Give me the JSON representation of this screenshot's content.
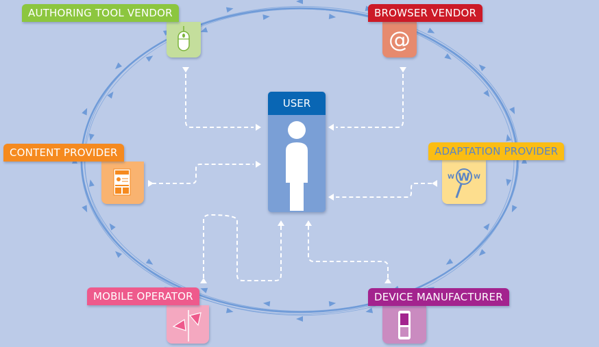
{
  "diagram": {
    "center": {
      "label": "USER",
      "icon": "person-icon",
      "header_color": "#0966b4",
      "body_color": "#7a9fd6"
    },
    "ring_color": "#6f9bd8",
    "connector_color": "#ffffff",
    "nodes": [
      {
        "id": "authoring-tool-vendor",
        "label": "AUTHORING TOOL VENDOR",
        "icon": "mouse-icon",
        "label_color": "#8cc63f",
        "tile_color": "#c4de9c"
      },
      {
        "id": "browser-vendor",
        "label": "BROWSER VENDOR",
        "icon": "at-sign-icon",
        "label_color": "#cc1a27",
        "tile_color": "#e68a6e"
      },
      {
        "id": "content-provider",
        "label": "CONTENT PROVIDER",
        "icon": "news-document-icon",
        "label_color": "#f58a1f",
        "tile_color": "#f9b370"
      },
      {
        "id": "adaptation-provider",
        "label": "ADAPTATION PROVIDER",
        "icon": "www-magnifier-icon",
        "label_color": "#fbbd13",
        "tile_color": "#fdde8e",
        "text_color": "#5b85c4"
      },
      {
        "id": "mobile-operator",
        "label": "MOBILE OPERATOR",
        "icon": "antenna-icon",
        "label_color": "#ee5a8c",
        "tile_color": "#f4a8c0"
      },
      {
        "id": "device-manufacturer",
        "label": "DEVICE MANUFACTURER",
        "icon": "mobile-phone-icon",
        "label_color": "#a3238e",
        "tile_color": "#ca8bc0"
      }
    ]
  }
}
